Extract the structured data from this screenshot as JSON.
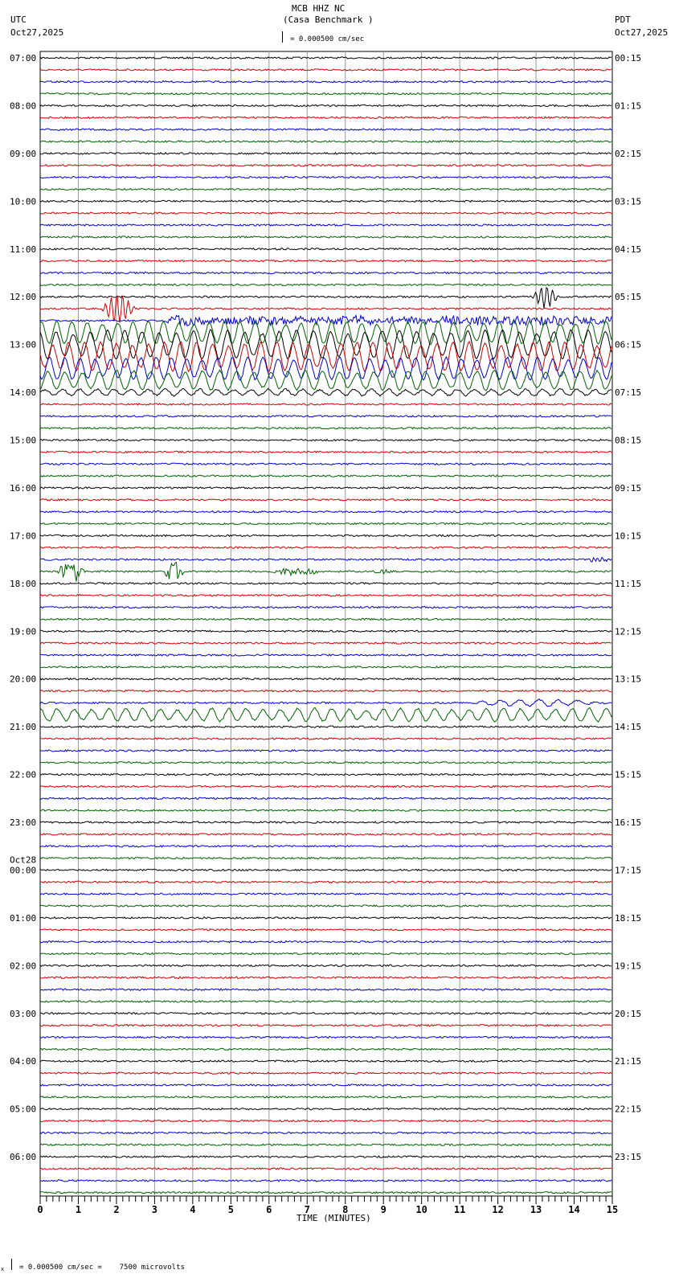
{
  "header": {
    "station": "MCB HHZ NC",
    "site": "(Casa Benchmark )",
    "left_tz": "UTC",
    "left_date": "Oct27,2025",
    "right_tz": "PDT",
    "right_date": "Oct27,2025",
    "scale": "= 0.000500 cm/sec"
  },
  "footer": {
    "scale": "= 0.000500 cm/sec =    7500 microvolts",
    "marker": "x"
  },
  "chart_data": {
    "type": "line",
    "title": "MCB HHZ NC (Casa Benchmark )",
    "xlabel": "TIME (MINUTES)",
    "xlim": [
      0,
      15
    ],
    "x_ticks": [
      "0",
      "1",
      "2",
      "3",
      "4",
      "5",
      "6",
      "7",
      "8",
      "9",
      "10",
      "11",
      "12",
      "13",
      "14",
      "15"
    ],
    "trace_colors": [
      "#000000",
      "#d00000",
      "#0000d0",
      "#006000"
    ],
    "traces_per_hour": 4,
    "left_labels": [
      "07:00",
      "08:00",
      "09:00",
      "10:00",
      "11:00",
      "12:00",
      "13:00",
      "14:00",
      "15:00",
      "16:00",
      "17:00",
      "18:00",
      "19:00",
      "20:00",
      "21:00",
      "22:00",
      "23:00",
      "00:00",
      "01:00",
      "02:00",
      "03:00",
      "04:00",
      "05:00",
      "06:00"
    ],
    "date_change_label": "Oct28",
    "right_labels": [
      "00:15",
      "01:15",
      "02:15",
      "03:15",
      "04:15",
      "05:15",
      "06:15",
      "07:15",
      "08:15",
      "09:15",
      "10:15",
      "11:15",
      "12:15",
      "13:15",
      "14:15",
      "15:15",
      "16:15",
      "17:15",
      "18:15",
      "19:15",
      "20:15",
      "21:15",
      "22:15",
      "23:15"
    ],
    "events": [
      {
        "trace": 21,
        "start": 1.6,
        "end": 2.5,
        "amp": 18,
        "period": 0.15
      },
      {
        "trace": 20,
        "start": 12.9,
        "end": 13.6,
        "amp": 14,
        "period": 0.15
      },
      {
        "trace": 22,
        "start": 3.3,
        "end": 15,
        "amp": 6,
        "period": 0.08
      },
      {
        "trace": 23,
        "start": 0,
        "end": 15,
        "amp": 14,
        "period": 0.4
      },
      {
        "trace": 24,
        "start": 0,
        "end": 15,
        "amp": 18,
        "period": 0.45
      },
      {
        "trace": 25,
        "start": 0,
        "end": 15,
        "amp": 18,
        "period": 0.42
      },
      {
        "trace": 26,
        "start": 0,
        "end": 15,
        "amp": 14,
        "period": 0.4
      },
      {
        "trace": 27,
        "start": 0,
        "end": 15,
        "amp": 12,
        "period": 0.45
      },
      {
        "trace": 28,
        "start": 0,
        "end": 15,
        "amp": 4,
        "period": 0.45
      },
      {
        "trace": 43,
        "start": 0.4,
        "end": 1.2,
        "amp": 14,
        "period": 0.04
      },
      {
        "trace": 43,
        "start": 3.2,
        "end": 3.8,
        "amp": 14,
        "period": 0.04
      },
      {
        "trace": 43,
        "start": 6.0,
        "end": 7.4,
        "amp": 6,
        "period": 0.04
      },
      {
        "trace": 43,
        "start": 8.7,
        "end": 9.2,
        "amp": 3,
        "period": 0.04
      },
      {
        "trace": 42,
        "start": 14.3,
        "end": 15,
        "amp": 3,
        "period": 0.04
      },
      {
        "trace": 54,
        "start": 11,
        "end": 15,
        "amp": 4,
        "period": 0.5
      },
      {
        "trace": 55,
        "start": 0,
        "end": 15,
        "amp": 8,
        "period": 0.45
      }
    ]
  }
}
